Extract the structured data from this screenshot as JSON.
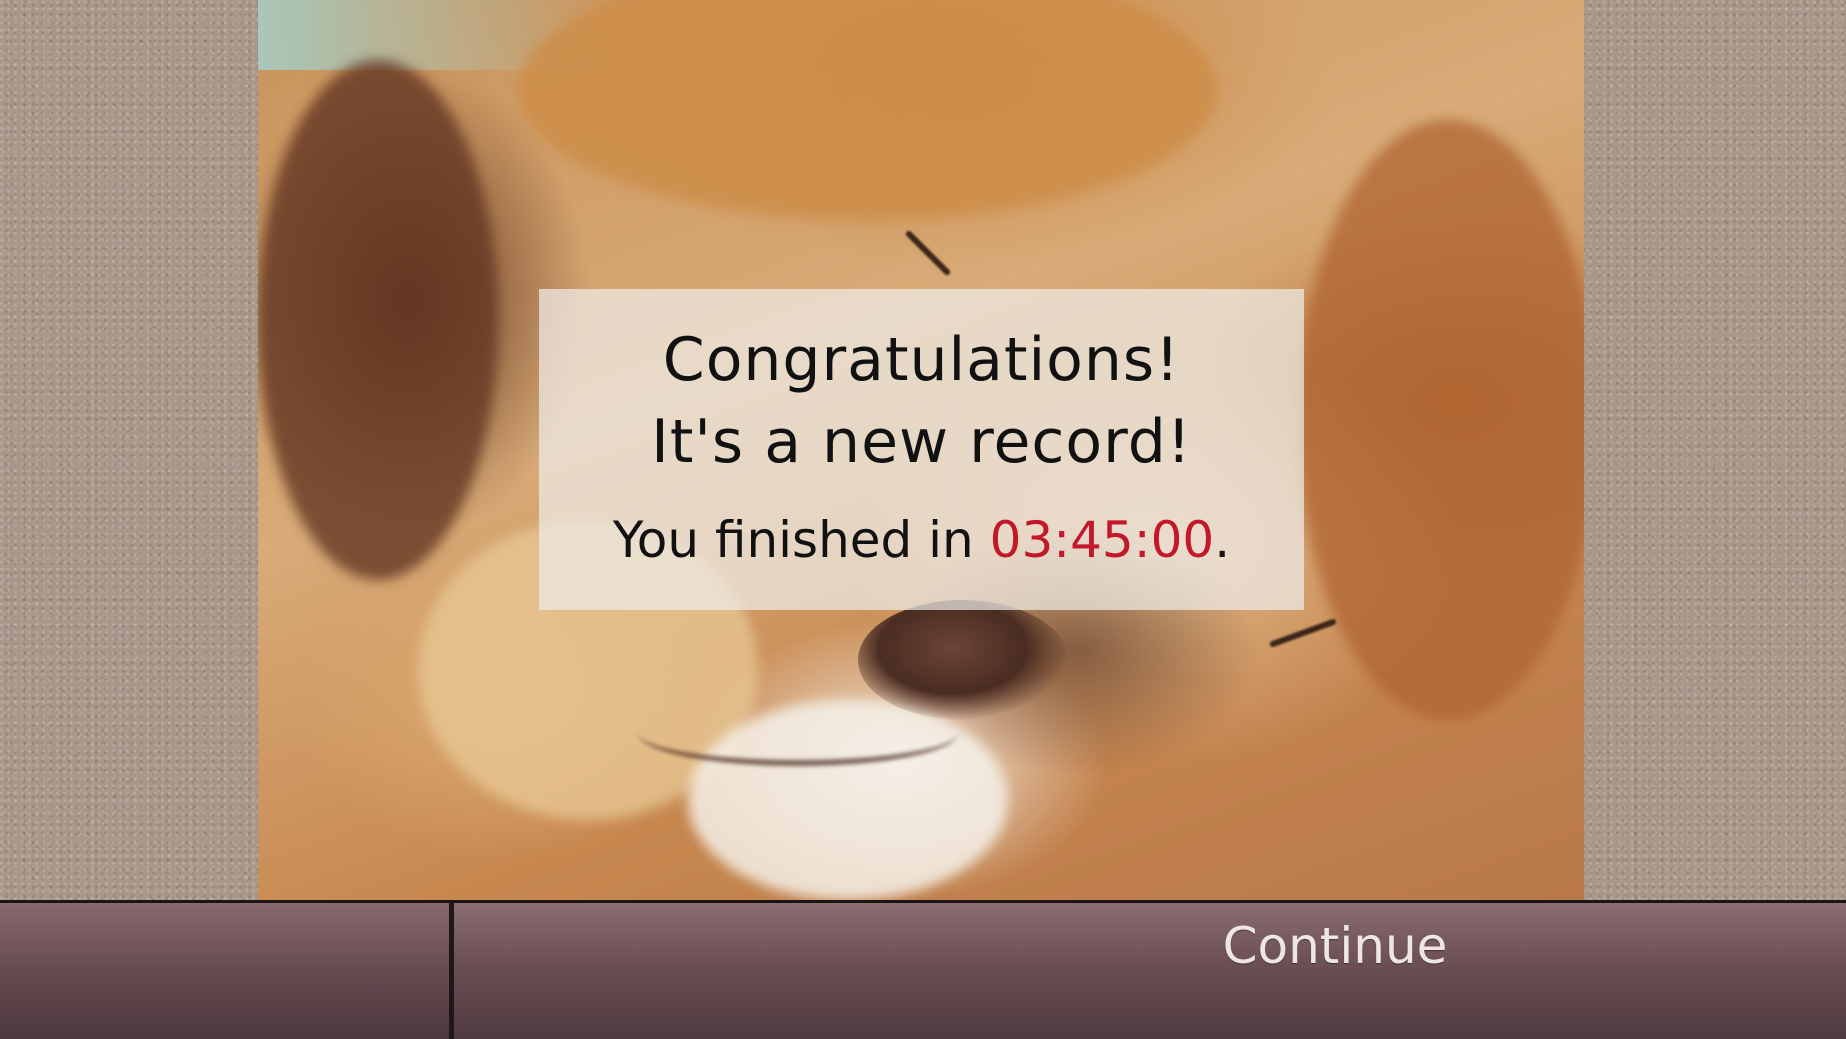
{
  "record_dialog": {
    "heading_line1": "Congratulations!",
    "heading_line2": "It's a new record!",
    "finish_prefix": "You finished in ",
    "finish_time": "03:45:00",
    "finish_suffix": "."
  },
  "bottom_bar": {
    "continue_label": "Continue"
  },
  "colors": {
    "time_highlight": "#c3182a",
    "bar_top": "#8a6c72",
    "bar_bottom": "#4f3a3f"
  }
}
